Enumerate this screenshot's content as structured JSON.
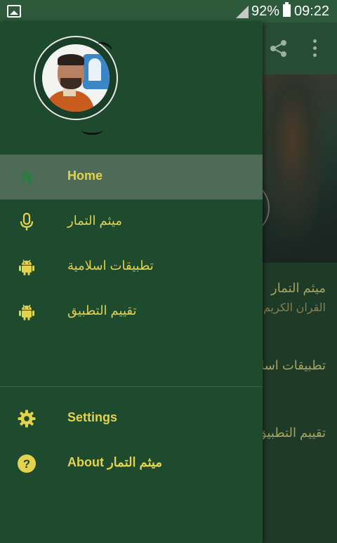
{
  "status_bar": {
    "battery": "92%",
    "time": "09:22",
    "icons": [
      "gallery-icon",
      "signal-icon",
      "battery-icon"
    ]
  },
  "drawer": {
    "menu": [
      {
        "label": "Home",
        "icon": "home-icon",
        "active": true
      },
      {
        "label": "ميثم التمار",
        "icon": "microphone-icon",
        "active": false
      },
      {
        "label": "تطبيقات اسلامية",
        "icon": "android-icon",
        "active": false
      },
      {
        "label": "تقييم التطبيق",
        "icon": "android-icon",
        "active": false
      }
    ],
    "footer": [
      {
        "label": "Settings",
        "icon": "gear-icon"
      },
      {
        "label": "About ميثم التمار",
        "icon": "help-icon"
      }
    ]
  },
  "background_app": {
    "toolbar_icons": [
      "share-icon",
      "more-vert-icon"
    ],
    "cards": [
      {
        "title": "ميثم التمار",
        "subtitle": "القران الكريم"
      },
      {
        "title": "تطبيقات اسلامية"
      },
      {
        "title": "تقييم التطبيق"
      }
    ]
  },
  "colors": {
    "accent": "#e2d24c",
    "drawer_bg": "#1e4a2e",
    "active_item_bg": "#4d6b56",
    "status_bar_bg": "#2c5a3b"
  }
}
